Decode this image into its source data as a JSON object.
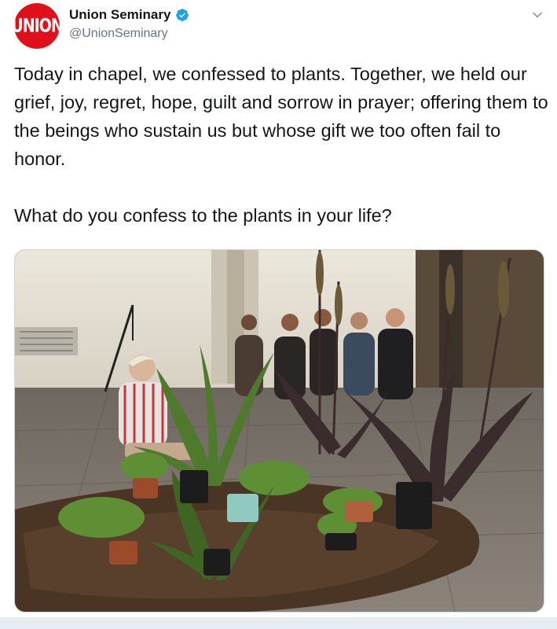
{
  "account": {
    "display_name": "Union Seminary",
    "handle": "@UnionSeminary",
    "avatar_text": "UNION",
    "verified": true
  },
  "tweet": {
    "text": "Today in chapel, we confessed to plants. Together, we held our grief, joy, regret, hope, guilt and sorrow in prayer; offering them to the beings who sustain us but whose gift we too often fail to honor.\n\nWhat do you confess to the plants in your life?"
  },
  "colors": {
    "avatar_bg": "#e0101a",
    "verified": "#1da1f2",
    "handle": "#657786",
    "text": "#14171a"
  },
  "icons": {
    "verified": "verified-badge-icon",
    "menu": "chevron-down-icon"
  }
}
